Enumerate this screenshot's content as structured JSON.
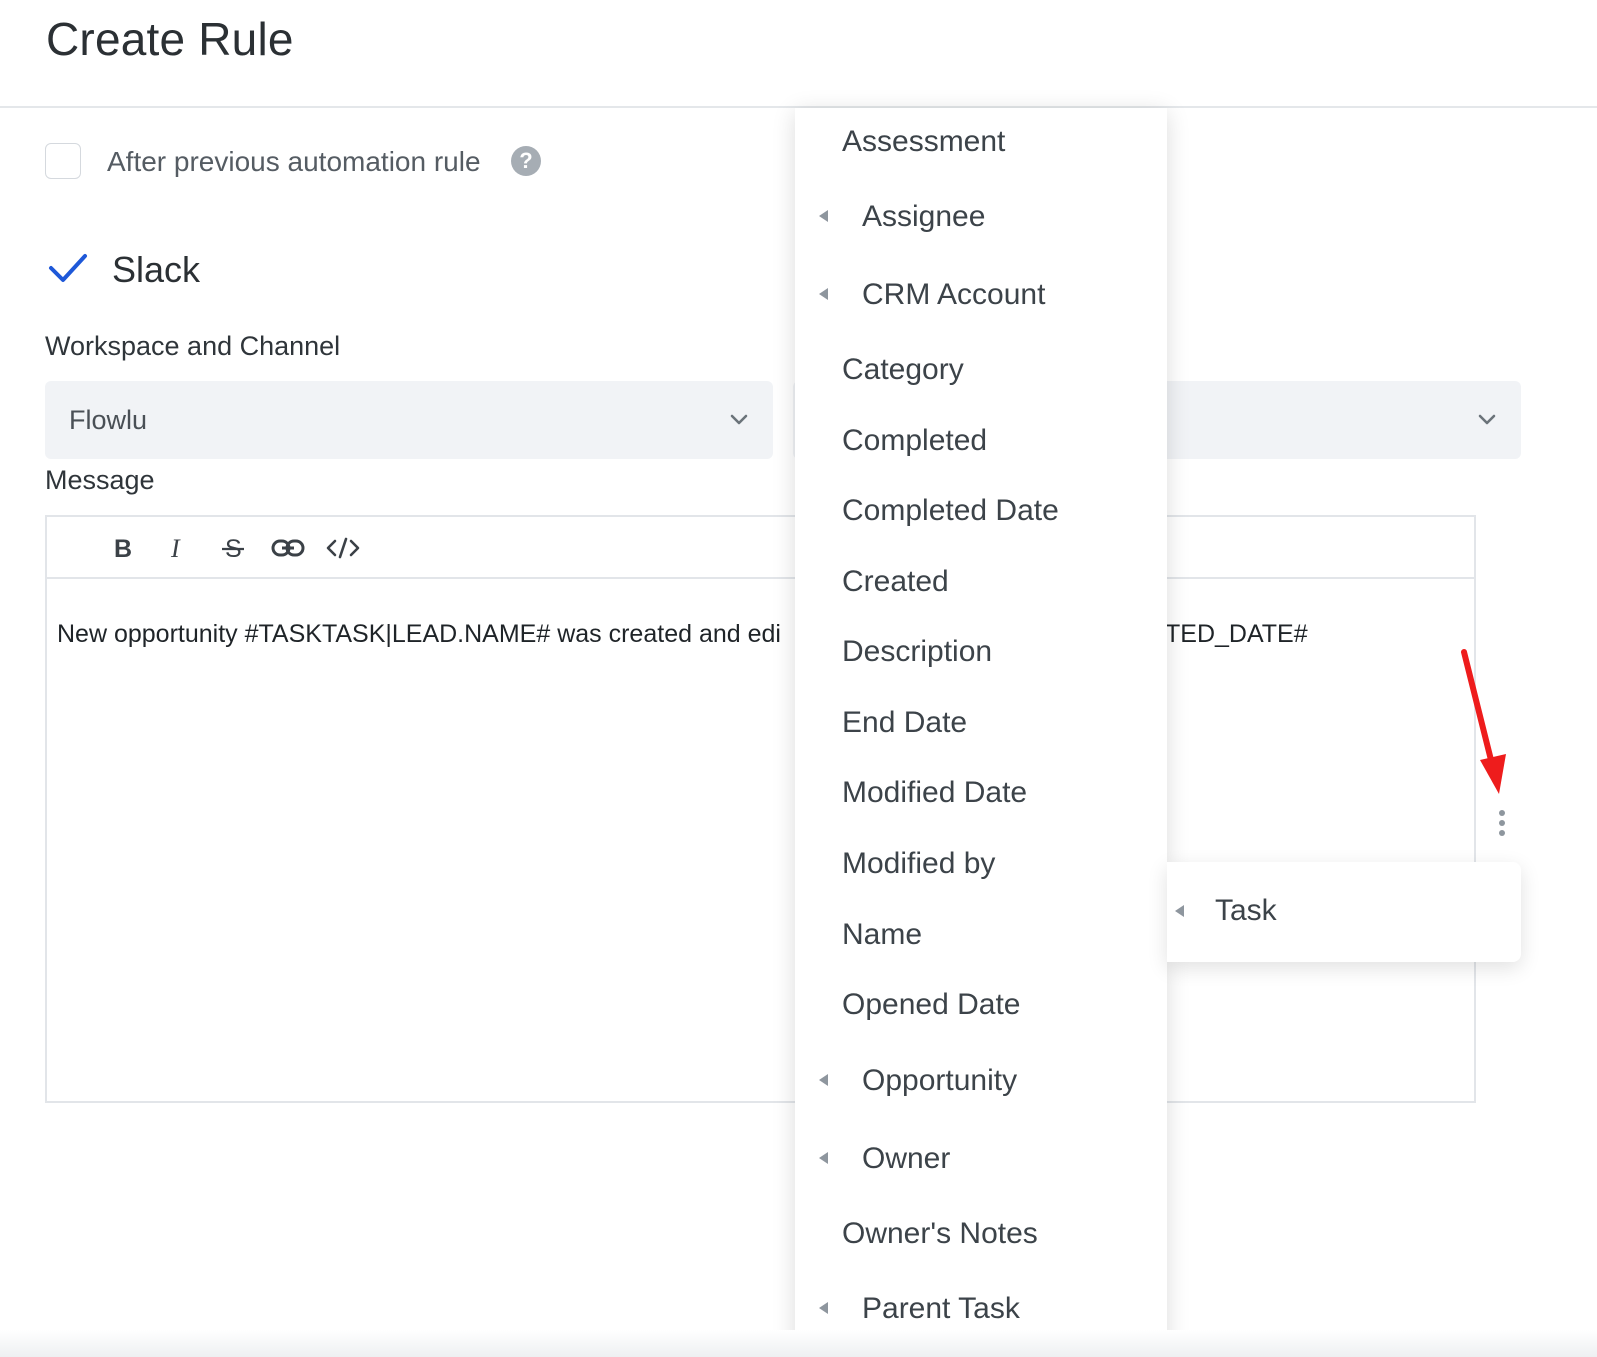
{
  "page": {
    "title": "Create Rule"
  },
  "automation": {
    "checkbox_label": "After previous automation rule",
    "help_icon": "?"
  },
  "action": {
    "title": "Slack",
    "check_icon": "checkmark-icon"
  },
  "workspace": {
    "label": "Workspace and Channel",
    "workspace_value": "Flowlu",
    "channel_value": ""
  },
  "message": {
    "label": "Message",
    "toolbar": [
      "bold",
      "italic",
      "strikethrough",
      "link",
      "code"
    ],
    "text_left": "New opportunity #TASKTASK|LEAD.NAME# was created and edi",
    "text_right": "TED_DATE#"
  },
  "field_menu": {
    "items": [
      {
        "label": "Assessment",
        "has_submenu": false
      },
      {
        "label": "Assignee",
        "has_submenu": true
      },
      {
        "label": "CRM Account",
        "has_submenu": true
      },
      {
        "label": "Category",
        "has_submenu": false
      },
      {
        "label": "Completed",
        "has_submenu": false
      },
      {
        "label": "Completed Date",
        "has_submenu": false
      },
      {
        "label": "Created",
        "has_submenu": false
      },
      {
        "label": "Description",
        "has_submenu": false
      },
      {
        "label": "End Date",
        "has_submenu": false
      },
      {
        "label": "Modified Date",
        "has_submenu": false
      },
      {
        "label": "Modified by",
        "has_submenu": false
      },
      {
        "label": "Name",
        "has_submenu": false
      },
      {
        "label": "Opened Date",
        "has_submenu": false
      },
      {
        "label": "Opportunity",
        "has_submenu": true
      },
      {
        "label": "Owner",
        "has_submenu": true
      },
      {
        "label": "Owner's Notes",
        "has_submenu": false
      },
      {
        "label": "Parent Task",
        "has_submenu": true
      }
    ]
  },
  "submenu": {
    "label": "Task"
  },
  "colors": {
    "accent_check": "#1e58d8",
    "annotation_arrow": "#ee1c1c"
  }
}
